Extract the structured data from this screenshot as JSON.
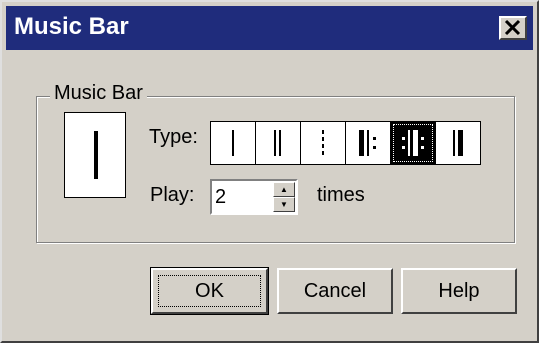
{
  "window": {
    "title": "Music Bar"
  },
  "icons": {
    "close": "close-x-icon"
  },
  "group": {
    "label": "Music Bar"
  },
  "type": {
    "label": "Type:",
    "options": [
      "single-barline",
      "double-barline",
      "dashed-barline",
      "repeat-start-barline",
      "repeat-both-barline",
      "final-barline"
    ],
    "selected": "repeat-both-barline"
  },
  "play": {
    "label": "Play:",
    "value": "2",
    "suffix": "times"
  },
  "buttons": {
    "ok": "OK",
    "cancel": "Cancel",
    "help": "Help"
  },
  "colors": {
    "titlebar": "#1f2c7c",
    "face": "#d4d0c8"
  }
}
